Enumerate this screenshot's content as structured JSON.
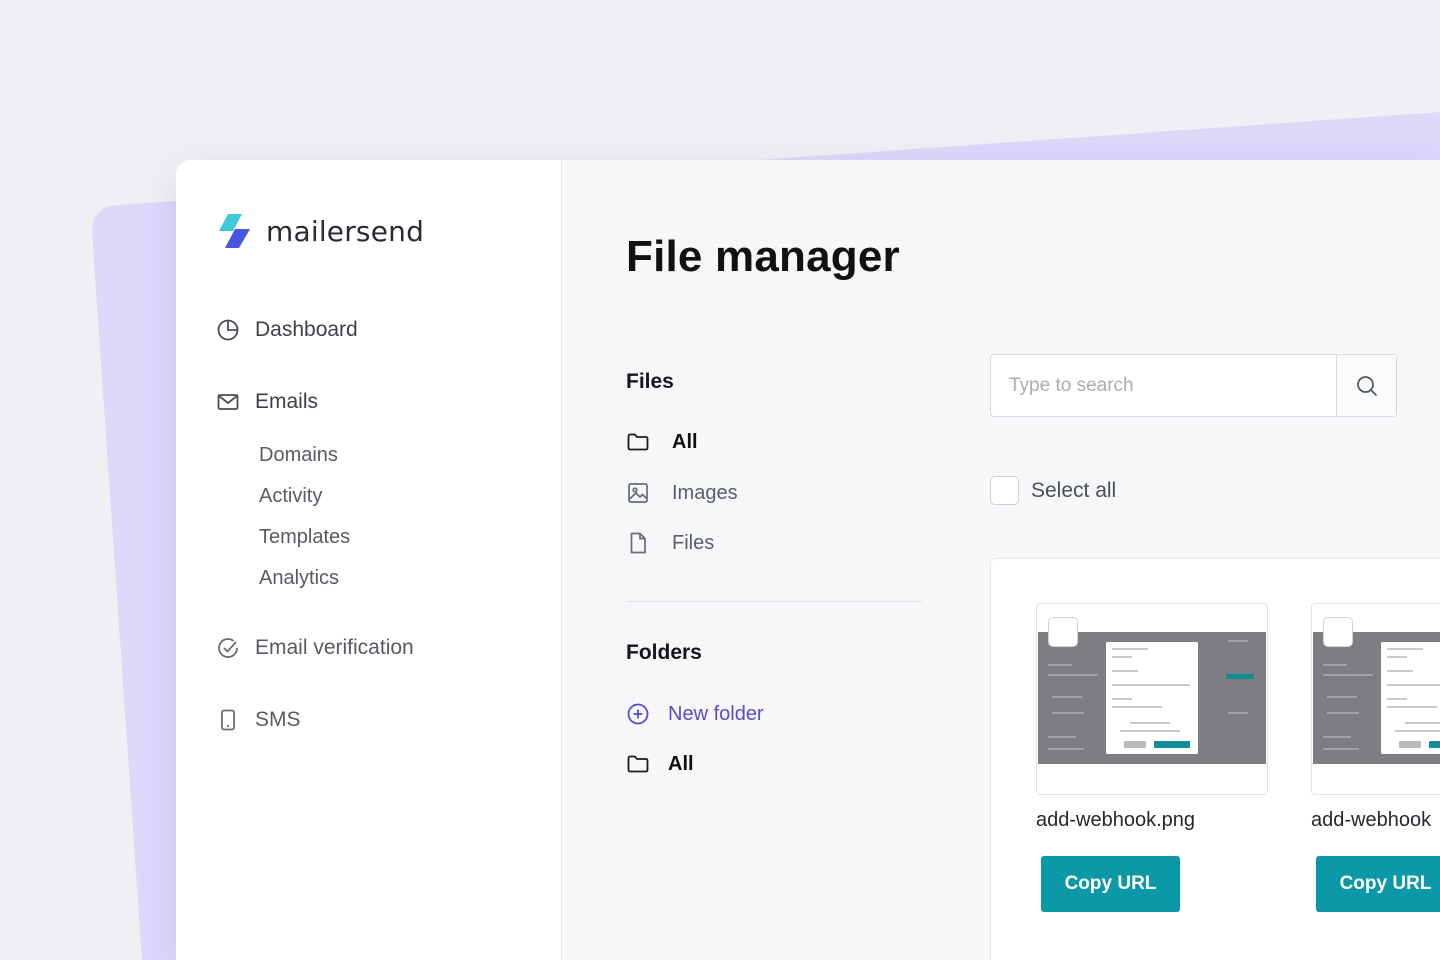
{
  "brand": {
    "name": "mailersend",
    "colors": {
      "primary_purple": "#5b49d6",
      "accent_teal": "#0b99a8",
      "logo_cyan": "#3ec8d8",
      "logo_blue": "#4a55e0"
    }
  },
  "sidebar": {
    "nav": [
      {
        "label": "Dashboard",
        "icon": "pie-chart-icon"
      },
      {
        "label": "Emails",
        "icon": "envelope-icon"
      },
      {
        "label": "Email verification",
        "icon": "check-circle-icon"
      },
      {
        "label": "SMS",
        "icon": "phone-icon"
      }
    ],
    "email_sub_items": [
      "Domains",
      "Activity",
      "Templates",
      "Analytics"
    ]
  },
  "main": {
    "title": "File manager",
    "files_section": {
      "label": "Files",
      "items": [
        {
          "label": "All",
          "icon": "folder-icon",
          "active": true
        },
        {
          "label": "Images",
          "icon": "image-icon"
        },
        {
          "label": "Files",
          "icon": "file-icon"
        }
      ]
    },
    "folders_section": {
      "label": "Folders",
      "new_folder": {
        "label": "New folder",
        "icon": "plus-circle-icon"
      },
      "items": [
        {
          "label": "All",
          "icon": "folder-icon"
        }
      ]
    },
    "search": {
      "placeholder": "Type to search",
      "icon": "search-icon"
    },
    "select_all_label": "Select all",
    "files": [
      {
        "name": "add-webhook.png",
        "button": "Copy URL"
      },
      {
        "name": "add-webhook",
        "button": "Copy URL"
      }
    ]
  }
}
